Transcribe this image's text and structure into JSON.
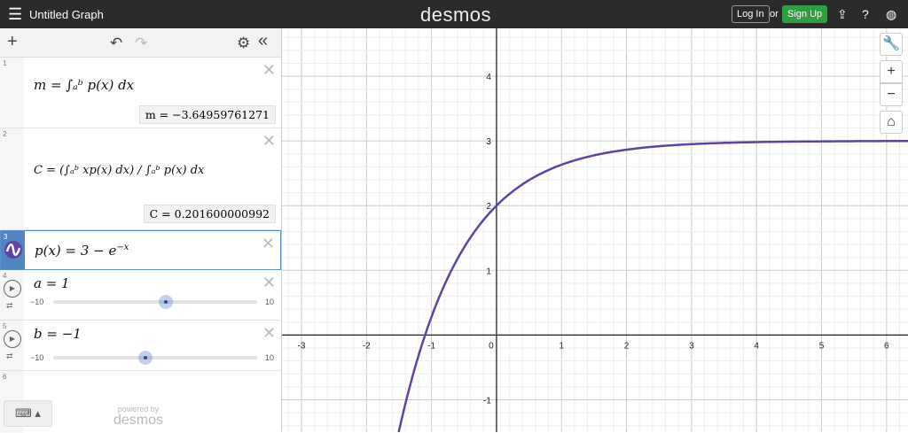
{
  "header": {
    "title": "Untitled Graph",
    "logo": "desmos",
    "login": "Log In",
    "or": "or",
    "signup": "Sign Up"
  },
  "toolbar": {
    "add": "+",
    "undo": "↶",
    "redo": "↷",
    "settings": "⚙",
    "collapse": "«"
  },
  "expressions": [
    {
      "num": "1",
      "latex": "m = ∫ₐᵇ p(x) dx",
      "result": "m = −3.64959761271"
    },
    {
      "num": "2",
      "latex": "C = (∫ₐᵇ xp(x) dx) / ∫ₐᵇ p(x) dx",
      "result": "C = 0.201600000992"
    },
    {
      "num": "3",
      "latex": "p(x) = 3 − e",
      "sup": "−x"
    },
    {
      "num": "4",
      "latex": "a = 1",
      "min": "−10",
      "max": "10",
      "value": 1
    },
    {
      "num": "5",
      "latex": "b = −1",
      "min": "−10",
      "max": "10",
      "value": -1
    },
    {
      "num": "6"
    }
  ],
  "footer": {
    "powered": "powered by",
    "brand": "desmos"
  },
  "colors": {
    "curve": "#6042a6",
    "accent": "#2f9e3e"
  },
  "chart_data": {
    "type": "line",
    "function": "p(x)=3-e^(-x)",
    "xlim": [
      -3.3,
      6.33
    ],
    "ylim": [
      -1.5,
      4.74
    ],
    "xticks": [
      "-3",
      "-2",
      "-1",
      "0",
      "1",
      "2",
      "3",
      "4",
      "5",
      "6"
    ],
    "yticks": [
      "-1",
      "1",
      "2",
      "3",
      "4"
    ],
    "grid": true
  }
}
